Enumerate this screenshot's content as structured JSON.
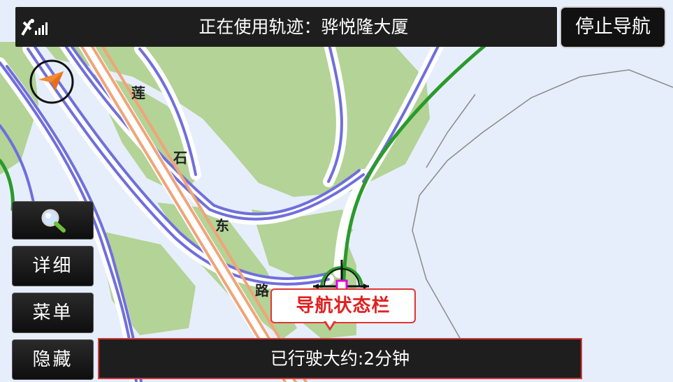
{
  "header": {
    "track_status": "正在使用轨迹：骅悦隆大厦",
    "signal_icon": "gps-signal-icon"
  },
  "controls": {
    "stop_navigation": "停止导航",
    "search_icon": "magnifier-icon",
    "detail": "详细",
    "menu": "菜单",
    "hide": "隐藏"
  },
  "map": {
    "road_labels": [
      "莲",
      "石",
      "东",
      "路"
    ],
    "compass_icon": "compass-arrow-icon",
    "vehicle_icon": "vehicle-position-icon",
    "colors": {
      "background": "#e6eefb",
      "green_area": "#b3d397",
      "road_blue": "#6f6fdc",
      "main_road": "#f0a47a",
      "route_green": "#2a9a2a"
    }
  },
  "callout": {
    "label": "导航状态栏"
  },
  "status_bar": {
    "text": "已行驶大约:2分钟",
    "border_color": "#d43a3a"
  }
}
